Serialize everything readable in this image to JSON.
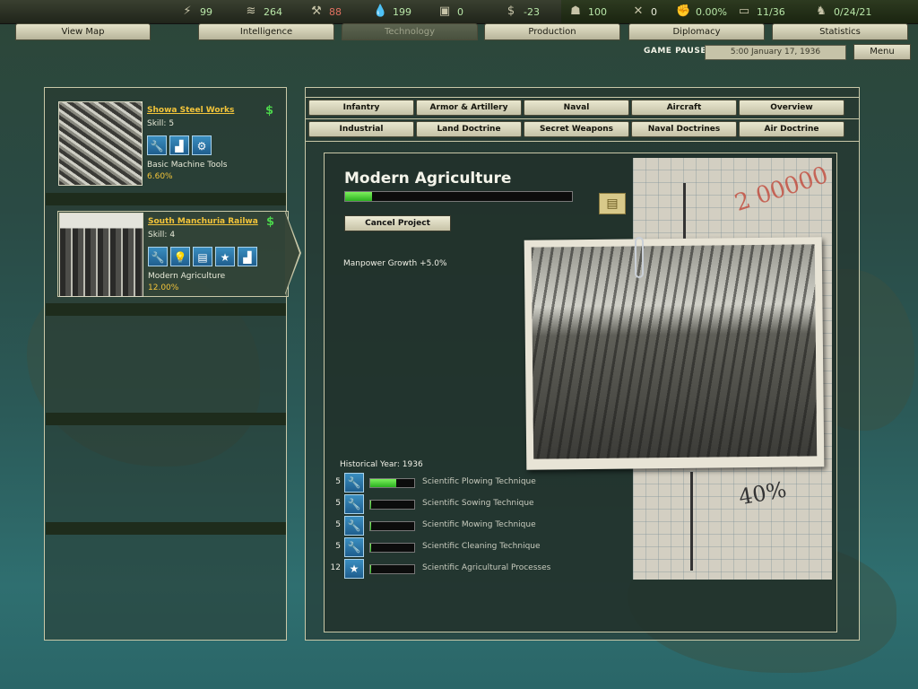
{
  "resources": [
    {
      "icon": "energy-icon",
      "value": "99",
      "negative": false
    },
    {
      "icon": "metal-icon",
      "value": "264",
      "negative": false
    },
    {
      "icon": "rare-materials-icon",
      "value": "88",
      "negative": true
    },
    {
      "icon": "oil-icon",
      "value": "199",
      "negative": false
    },
    {
      "icon": "supplies-icon",
      "value": "0",
      "negative": false
    },
    {
      "icon": "money-icon",
      "value": "-23",
      "negative": false
    },
    {
      "icon": "manpower-icon",
      "value": "100",
      "negative": false
    },
    {
      "icon": "diplomacy-icon",
      "value": "0",
      "negative": false
    },
    {
      "icon": "dissent-icon",
      "value": "0.00%",
      "negative": false
    },
    {
      "icon": "transport-icon",
      "value": "11/36",
      "negative": false
    },
    {
      "icon": "officers-icon",
      "value": "0/24/21",
      "negative": false
    }
  ],
  "tabs": [
    "View Map",
    "Intelligence",
    "Technology",
    "Production",
    "Diplomacy",
    "Statistics"
  ],
  "active_tab": "Technology",
  "status": {
    "paused": "GAME PAUSED",
    "date": "5:00 January 17, 1936",
    "menu": "Menu"
  },
  "teams": [
    {
      "name": "Showa Steel Works",
      "skill": "Skill: 5",
      "project": "Basic Machine Tools",
      "progress": "6.60%",
      "icons": [
        "wrench-icon",
        "factory-icon",
        "gears-icon"
      ]
    },
    {
      "name": "South Manchuria Railwa",
      "skill": "Skill: 4",
      "project": "Modern Agriculture",
      "progress": "12.00%",
      "icons": [
        "wrench-icon",
        "lightbulb-icon",
        "computer-icon",
        "star-icon",
        "factory-icon"
      ]
    }
  ],
  "categories_row1": [
    "Infantry",
    "Armor & Artillery",
    "Naval",
    "Aircraft",
    "Overview"
  ],
  "categories_row2": [
    "Industrial",
    "Land Doctrine",
    "Secret Weapons",
    "Naval Doctrines",
    "Air Doctrine"
  ],
  "tech": {
    "title": "Modern Agriculture",
    "progress": 0.12,
    "cancel_label": "Cancel Project",
    "effect": "Manpower Growth +5.0%",
    "historical_year": "Historical Year: 1936",
    "components": [
      {
        "level": "5",
        "icon": "wrench-icon",
        "name": "Scientific Plowing Technique",
        "progress": 0.6
      },
      {
        "level": "5",
        "icon": "wrench-icon",
        "name": "Scientific Sowing Technique",
        "progress": 0.03
      },
      {
        "level": "5",
        "icon": "wrench-icon",
        "name": "Scientific Mowing Technique",
        "progress": 0.03
      },
      {
        "level": "5",
        "icon": "wrench-icon",
        "name": "Scientific Cleaning Technique",
        "progress": 0.03
      },
      {
        "level": "12",
        "icon": "star-icon",
        "name": "Scientific Agricultural Processes",
        "progress": 0.03
      }
    ]
  },
  "colors": {
    "progress": "#2bb020",
    "accent": "#f2c43a",
    "money": "#4bd44b"
  }
}
